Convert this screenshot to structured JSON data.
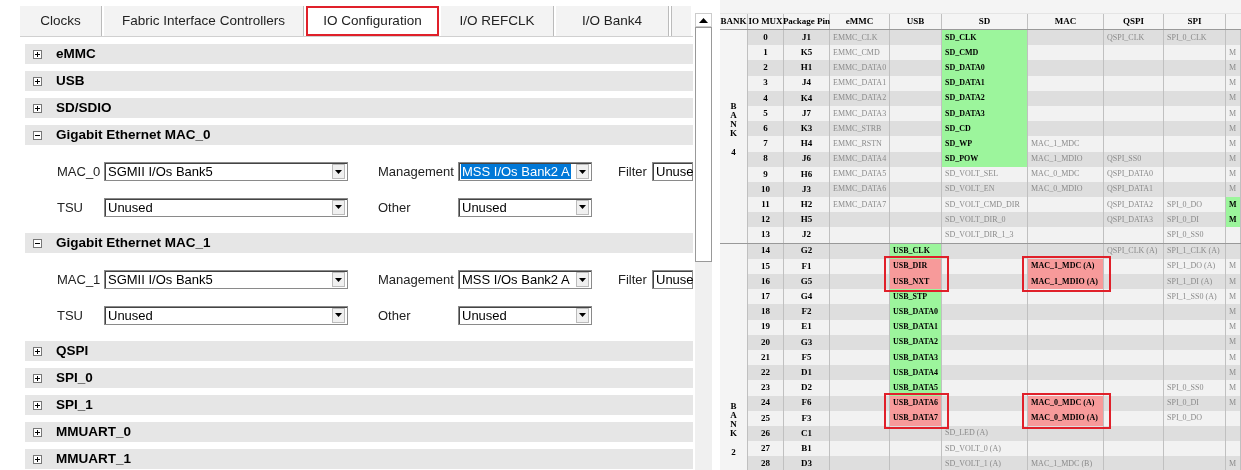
{
  "tabs": [
    {
      "label": "Clocks",
      "selected": false,
      "highlighted": false
    },
    {
      "label": "Fabric Interface Controllers",
      "selected": false,
      "highlighted": false
    },
    {
      "label": "IO Configuration",
      "selected": true,
      "highlighted": true
    },
    {
      "label": "I/O REFCLK",
      "selected": false,
      "highlighted": false
    },
    {
      "label": "I/O Bank4",
      "selected": false,
      "highlighted": false
    }
  ],
  "sections": [
    {
      "title": "eMMC",
      "expanded": false
    },
    {
      "title": "USB",
      "expanded": false
    },
    {
      "title": "SD/SDIO",
      "expanded": false
    },
    {
      "title": "Gigabit Ethernet MAC_0",
      "expanded": true,
      "rows": [
        {
          "fields": [
            {
              "label": "MAC_0",
              "value": "SGMII I/Os Bank5",
              "focused": false
            },
            {
              "label": "Management",
              "value": "MSS I/Os Bank2 A",
              "focused": true
            },
            {
              "label": "Filter",
              "value": "Unuse",
              "focused": false
            }
          ]
        },
        {
          "fields": [
            {
              "label": "TSU",
              "value": "Unused",
              "focused": false
            },
            {
              "label": "Other",
              "value": "Unused",
              "focused": false
            }
          ]
        }
      ]
    },
    {
      "title": "Gigabit Ethernet MAC_1",
      "expanded": true,
      "rows": [
        {
          "fields": [
            {
              "label": "MAC_1",
              "value": "SGMII I/Os Bank5",
              "focused": false
            },
            {
              "label": "Management",
              "value": "MSS I/Os Bank2 A",
              "focused": false
            },
            {
              "label": "Filter",
              "value": "Unuse",
              "focused": false
            }
          ]
        },
        {
          "fields": [
            {
              "label": "TSU",
              "value": "Unused",
              "focused": false
            },
            {
              "label": "Other",
              "value": "Unused",
              "focused": false
            }
          ]
        }
      ]
    },
    {
      "title": "QSPI",
      "expanded": false
    },
    {
      "title": "SPI_0",
      "expanded": false
    },
    {
      "title": "SPI_1",
      "expanded": false
    },
    {
      "title": "MMUART_0",
      "expanded": false
    },
    {
      "title": "MMUART_1",
      "expanded": false
    }
  ],
  "table": {
    "columns": [
      "BANK",
      "IO MUX",
      "Package Pin",
      "eMMC",
      "USB",
      "SD",
      "MAC",
      "QSPI",
      "SPI"
    ],
    "banks": [
      {
        "label": "BANK",
        "number": "4",
        "rows": [
          {
            "mux": "0",
            "pin": "J1",
            "cells": [
              {
                "text": "EMMC_CLK",
                "kind": "plain"
              },
              null,
              {
                "text": "SD_CLK",
                "kind": "active"
              },
              null,
              {
                "text": "QSPI_CLK",
                "kind": "plain"
              },
              {
                "text": "SPI_0_CLK",
                "kind": "plain"
              },
              null
            ]
          },
          {
            "mux": "1",
            "pin": "K5",
            "cells": [
              {
                "text": "EMMC_CMD",
                "kind": "plain"
              },
              null,
              {
                "text": "SD_CMD",
                "kind": "active"
              },
              null,
              null,
              null,
              {
                "text": "M",
                "kind": "plain"
              }
            ]
          },
          {
            "mux": "2",
            "pin": "H1",
            "cells": [
              {
                "text": "EMMC_DATA0",
                "kind": "plain"
              },
              null,
              {
                "text": "SD_DATA0",
                "kind": "active"
              },
              null,
              null,
              null,
              {
                "text": "M",
                "kind": "plain"
              }
            ]
          },
          {
            "mux": "3",
            "pin": "J4",
            "cells": [
              {
                "text": "EMMC_DATA1",
                "kind": "plain"
              },
              null,
              {
                "text": "SD_DATA1",
                "kind": "active"
              },
              null,
              null,
              null,
              {
                "text": "M",
                "kind": "plain"
              }
            ]
          },
          {
            "mux": "4",
            "pin": "K4",
            "cells": [
              {
                "text": "EMMC_DATA2",
                "kind": "plain"
              },
              null,
              {
                "text": "SD_DATA2",
                "kind": "active"
              },
              null,
              null,
              null,
              {
                "text": "M",
                "kind": "plain"
              }
            ]
          },
          {
            "mux": "5",
            "pin": "J7",
            "cells": [
              {
                "text": "EMMC_DATA3",
                "kind": "plain"
              },
              null,
              {
                "text": "SD_DATA3",
                "kind": "active"
              },
              null,
              null,
              null,
              {
                "text": "M",
                "kind": "plain"
              }
            ]
          },
          {
            "mux": "6",
            "pin": "K3",
            "cells": [
              {
                "text": "EMMC_STRB",
                "kind": "plain"
              },
              null,
              {
                "text": "SD_CD",
                "kind": "active"
              },
              null,
              null,
              null,
              {
                "text": "M",
                "kind": "plain"
              }
            ]
          },
          {
            "mux": "7",
            "pin": "H4",
            "cells": [
              {
                "text": "EMMC_RSTN",
                "kind": "plain"
              },
              null,
              {
                "text": "SD_WP",
                "kind": "active"
              },
              {
                "text": "MAC_1_MDC",
                "kind": "plain"
              },
              null,
              null,
              {
                "text": "M",
                "kind": "plain"
              }
            ]
          },
          {
            "mux": "8",
            "pin": "J6",
            "cells": [
              {
                "text": "EMMC_DATA4",
                "kind": "plain"
              },
              null,
              {
                "text": "SD_POW",
                "kind": "active"
              },
              {
                "text": "MAC_1_MDIO",
                "kind": "plain"
              },
              {
                "text": "QSPI_SS0",
                "kind": "plain"
              },
              null,
              {
                "text": "M",
                "kind": "plain"
              }
            ]
          },
          {
            "mux": "9",
            "pin": "H6",
            "cells": [
              {
                "text": "EMMC_DATA5",
                "kind": "plain"
              },
              null,
              {
                "text": "SD_VOLT_SEL",
                "kind": "plain"
              },
              {
                "text": "MAC_0_MDC",
                "kind": "plain"
              },
              {
                "text": "QSPI_DATA0",
                "kind": "plain"
              },
              null,
              {
                "text": "M",
                "kind": "plain"
              }
            ]
          },
          {
            "mux": "10",
            "pin": "J3",
            "cells": [
              {
                "text": "EMMC_DATA6",
                "kind": "plain"
              },
              null,
              {
                "text": "SD_VOLT_EN",
                "kind": "plain"
              },
              {
                "text": "MAC_0_MDIO",
                "kind": "plain"
              },
              {
                "text": "QSPI_DATA1",
                "kind": "plain"
              },
              null,
              {
                "text": "M",
                "kind": "plain"
              }
            ]
          },
          {
            "mux": "11",
            "pin": "H2",
            "cells": [
              {
                "text": "EMMC_DATA7",
                "kind": "plain"
              },
              null,
              {
                "text": "SD_VOLT_CMD_DIR",
                "kind": "plain"
              },
              null,
              {
                "text": "QSPI_DATA2",
                "kind": "plain"
              },
              {
                "text": "SPI_0_DO",
                "kind": "plain"
              },
              {
                "text": "M",
                "kind": "active"
              }
            ]
          },
          {
            "mux": "12",
            "pin": "H5",
            "cells": [
              null,
              null,
              {
                "text": "SD_VOLT_DIR_0",
                "kind": "plain"
              },
              null,
              {
                "text": "QSPI_DATA3",
                "kind": "plain"
              },
              {
                "text": "SPI_0_DI",
                "kind": "plain"
              },
              {
                "text": "M",
                "kind": "active"
              }
            ]
          },
          {
            "mux": "13",
            "pin": "J2",
            "cells": [
              null,
              null,
              {
                "text": "SD_VOLT_DIR_1_3",
                "kind": "plain"
              },
              null,
              null,
              {
                "text": "SPI_0_SS0",
                "kind": "plain"
              },
              null
            ]
          }
        ]
      },
      {
        "label": "BANK",
        "number": "2",
        "rows": [
          {
            "mux": "14",
            "pin": "G2",
            "cells": [
              null,
              {
                "text": "USB_CLK",
                "kind": "active"
              },
              null,
              null,
              {
                "text": "QSPI_CLK (A)",
                "kind": "plain"
              },
              {
                "text": "SPI_1_CLK (A)",
                "kind": "plain"
              },
              null
            ]
          },
          {
            "mux": "15",
            "pin": "F1",
            "cells": [
              null,
              {
                "text": "USB_DIR",
                "kind": "conflict"
              },
              null,
              {
                "text": "MAC_1_MDC (A)",
                "kind": "conflict"
              },
              null,
              {
                "text": "SPI_1_DO (A)",
                "kind": "plain"
              },
              {
                "text": "M",
                "kind": "plain"
              }
            ]
          },
          {
            "mux": "16",
            "pin": "G5",
            "cells": [
              null,
              {
                "text": "USB_NXT",
                "kind": "conflict"
              },
              null,
              {
                "text": "MAC_1_MDIO (A)",
                "kind": "conflict"
              },
              null,
              {
                "text": "SPI_1_DI (A)",
                "kind": "plain"
              },
              {
                "text": "M",
                "kind": "plain"
              }
            ]
          },
          {
            "mux": "17",
            "pin": "G4",
            "cells": [
              null,
              {
                "text": "USB_STP",
                "kind": "active"
              },
              null,
              null,
              null,
              {
                "text": "SPI_1_SS0 (A)",
                "kind": "plain"
              },
              {
                "text": "M",
                "kind": "plain"
              }
            ]
          },
          {
            "mux": "18",
            "pin": "F2",
            "cells": [
              null,
              {
                "text": "USB_DATA0",
                "kind": "active"
              },
              null,
              null,
              null,
              null,
              {
                "text": "M",
                "kind": "plain"
              }
            ]
          },
          {
            "mux": "19",
            "pin": "E1",
            "cells": [
              null,
              {
                "text": "USB_DATA1",
                "kind": "active"
              },
              null,
              null,
              null,
              null,
              {
                "text": "M",
                "kind": "plain"
              }
            ]
          },
          {
            "mux": "20",
            "pin": "G3",
            "cells": [
              null,
              {
                "text": "USB_DATA2",
                "kind": "active"
              },
              null,
              null,
              null,
              null,
              {
                "text": "M",
                "kind": "plain"
              }
            ]
          },
          {
            "mux": "21",
            "pin": "F5",
            "cells": [
              null,
              {
                "text": "USB_DATA3",
                "kind": "active"
              },
              null,
              null,
              null,
              null,
              {
                "text": "M",
                "kind": "plain"
              }
            ]
          },
          {
            "mux": "22",
            "pin": "D1",
            "cells": [
              null,
              {
                "text": "USB_DATA4",
                "kind": "active"
              },
              null,
              null,
              null,
              null,
              {
                "text": "M",
                "kind": "plain"
              }
            ]
          },
          {
            "mux": "23",
            "pin": "D2",
            "cells": [
              null,
              {
                "text": "USB_DATA5",
                "kind": "active"
              },
              null,
              null,
              null,
              {
                "text": "SPI_0_SS0",
                "kind": "plain"
              },
              {
                "text": "M",
                "kind": "plain"
              }
            ]
          },
          {
            "mux": "24",
            "pin": "F6",
            "cells": [
              null,
              {
                "text": "USB_DATA6",
                "kind": "conflict"
              },
              null,
              {
                "text": "MAC_0_MDC (A)",
                "kind": "conflict"
              },
              null,
              {
                "text": "SPI_0_DI",
                "kind": "plain"
              },
              {
                "text": "M",
                "kind": "plain"
              }
            ]
          },
          {
            "mux": "25",
            "pin": "F3",
            "cells": [
              null,
              {
                "text": "USB_DATA7",
                "kind": "conflict"
              },
              null,
              {
                "text": "MAC_0_MDIO (A)",
                "kind": "conflict"
              },
              null,
              {
                "text": "SPI_0_DO",
                "kind": "plain"
              },
              null
            ]
          },
          {
            "mux": "26",
            "pin": "C1",
            "cells": [
              null,
              null,
              {
                "text": "SD_LED (A)",
                "kind": "plain"
              },
              null,
              null,
              null,
              null
            ]
          },
          {
            "mux": "27",
            "pin": "B1",
            "cells": [
              null,
              null,
              {
                "text": "SD_VOLT_0 (A)",
                "kind": "plain"
              },
              null,
              null,
              null,
              null
            ]
          },
          {
            "mux": "28",
            "pin": "D3",
            "cells": [
              null,
              null,
              {
                "text": "SD_VOLT_1 (A)",
                "kind": "plain"
              },
              {
                "text": "MAC_1_MDC (B)",
                "kind": "plain"
              },
              null,
              null,
              {
                "text": "M",
                "kind": "plain"
              }
            ]
          }
        ]
      }
    ]
  }
}
